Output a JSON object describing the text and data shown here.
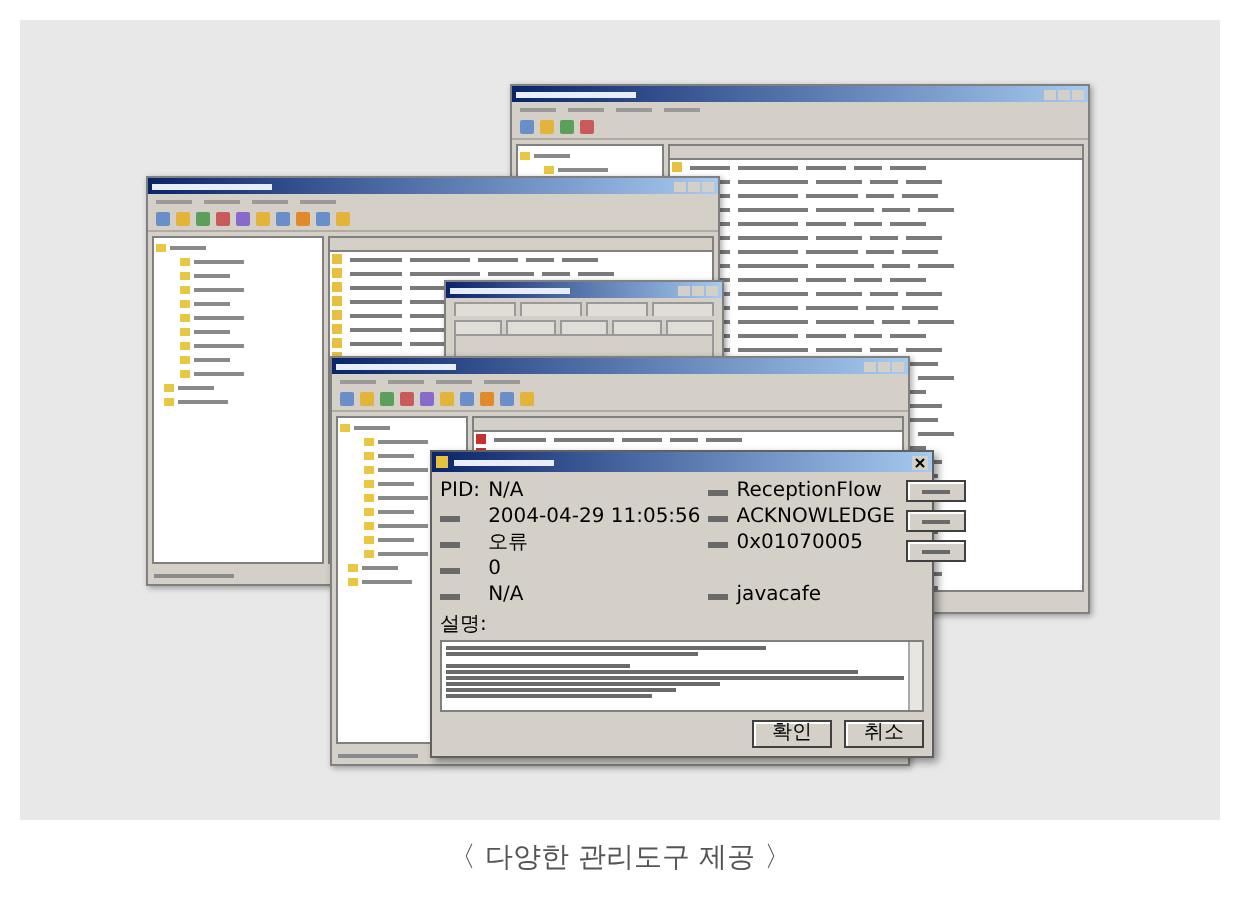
{
  "event_dialog": {
    "fields": [
      [
        {
          "label": "PID:",
          "value": "N/A"
        },
        {
          "value": "ReceptionFlow"
        }
      ],
      [
        {
          "value": "2004-04-29 11:05:56"
        },
        {
          "value": "ACKNOWLEDGE"
        }
      ],
      [
        {
          "value": "오류"
        },
        {
          "value": "0x01070005"
        }
      ],
      [
        {
          "value": "0"
        }
      ],
      [
        {
          "value": "N/A"
        },
        {
          "value": "javacafe"
        }
      ]
    ],
    "description_label": "설명:",
    "buttons": [
      "확인",
      "취소"
    ]
  },
  "caption": "〈 다양한 관리도구 제공 〉"
}
